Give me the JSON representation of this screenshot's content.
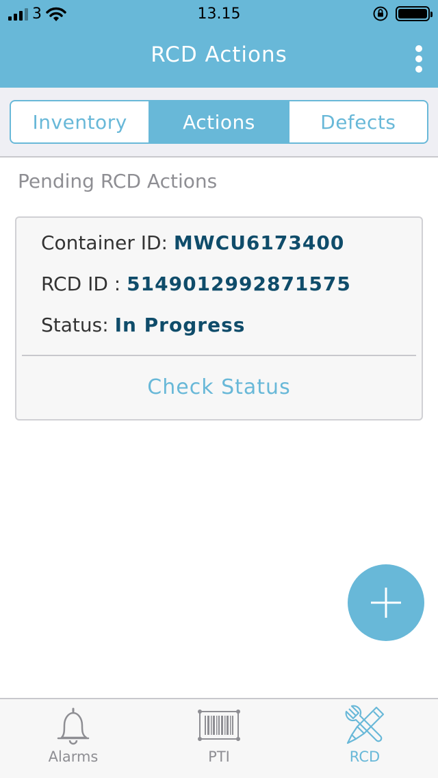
{
  "status_bar": {
    "carrier": "3",
    "time": "13.15"
  },
  "header": {
    "title": "RCD Actions",
    "menu_icon": "kebab-menu-icon"
  },
  "segments": [
    {
      "label": "Inventory",
      "active": false
    },
    {
      "label": "Actions",
      "active": true
    },
    {
      "label": "Defects",
      "active": false
    }
  ],
  "section_title": "Pending RCD Actions",
  "card": {
    "container_label": "Container ID:",
    "container_value": "MWCU6173400",
    "rcd_label": "RCD ID :",
    "rcd_value": "5149012992871575",
    "status_label": "Status:",
    "status_value": "In Progress",
    "action_label": "Check Status"
  },
  "fab": {
    "icon": "plus-icon"
  },
  "tabs": [
    {
      "label": "Alarms",
      "icon": "bell-icon",
      "active": false
    },
    {
      "label": "PTI",
      "icon": "barcode-icon",
      "active": false
    },
    {
      "label": "RCD",
      "icon": "tools-icon",
      "active": true
    }
  ],
  "colors": {
    "accent": "#68b8d8",
    "value_text": "#0f4c6a",
    "muted": "#8e8e93"
  }
}
